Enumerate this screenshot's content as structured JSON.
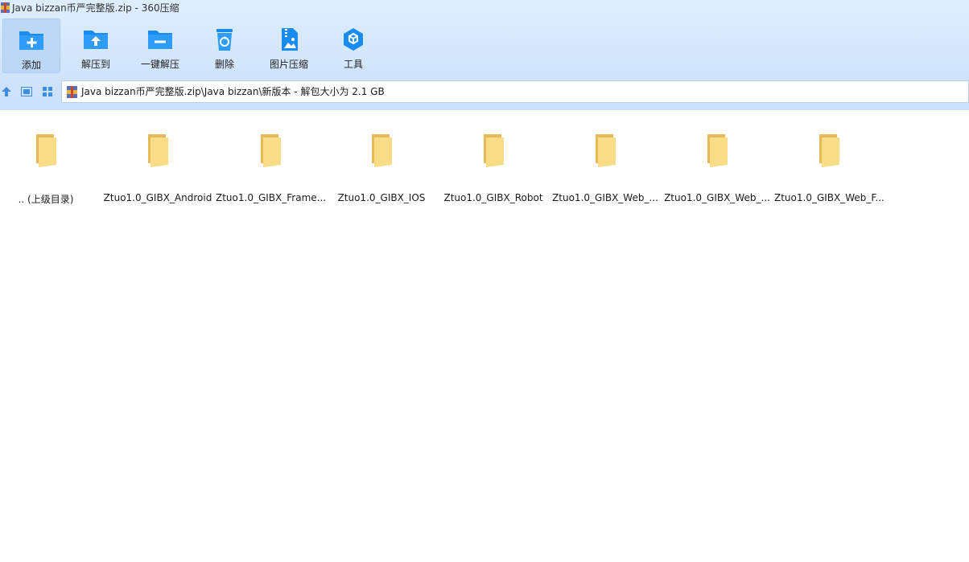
{
  "window": {
    "title": "Java bizzan币严完整版.zip - 360压缩"
  },
  "toolbar": {
    "buttons": [
      {
        "label": "添加",
        "icon": "add-folder-icon"
      },
      {
        "label": "解压到",
        "icon": "extract-to-icon"
      },
      {
        "label": "一键解压",
        "icon": "one-click-extract-icon"
      },
      {
        "label": "删除",
        "icon": "delete-recycle-icon"
      },
      {
        "label": "图片压缩",
        "icon": "image-compress-icon"
      },
      {
        "label": "工具",
        "icon": "tools-cube-icon"
      }
    ]
  },
  "nav": {
    "up_icon": "up-arrow-icon",
    "view_icon": "detail-view-icon",
    "grid_icon": "grid-view-icon"
  },
  "address": {
    "path": "Java bizzan币严完整版.zip\\Java bizzan\\新版本 - 解包大小为 2.1 GB"
  },
  "files": [
    {
      "name": ".. (上级目录)",
      "icon": "folder-icon"
    },
    {
      "name": "Ztuo1.0_GIBX_Android",
      "icon": "folder-icon"
    },
    {
      "name": "Ztuo1.0_GIBX_Frame...",
      "icon": "folder-icon"
    },
    {
      "name": "Ztuo1.0_GIBX_IOS",
      "icon": "folder-icon"
    },
    {
      "name": "Ztuo1.0_GIBX_Robot",
      "icon": "folder-icon"
    },
    {
      "name": "Ztuo1.0_GIBX_Web_...",
      "icon": "folder-icon"
    },
    {
      "name": "Ztuo1.0_GIBX_Web_...",
      "icon": "folder-icon"
    },
    {
      "name": "Ztuo1.0_GIBX_Web_F...",
      "icon": "folder-icon"
    }
  ],
  "colors": {
    "accent": "#1a8cf0",
    "folder": "#f7d97a",
    "toolbar_bg": "#d3e7fc"
  }
}
